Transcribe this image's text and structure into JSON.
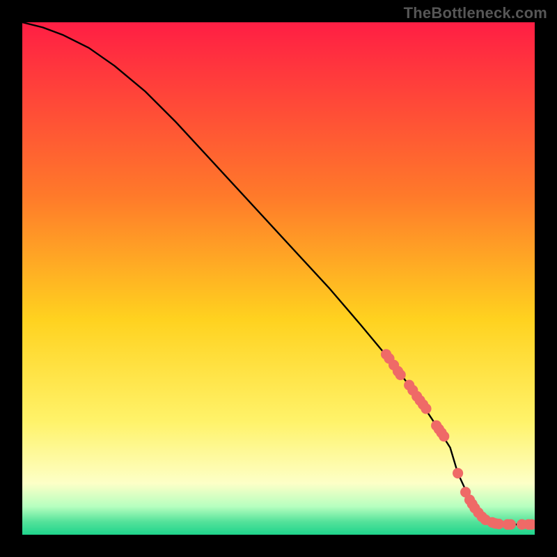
{
  "attribution": "TheBottleneck.com",
  "colors": {
    "bg_black": "#000000",
    "grad_top": "#ff1e44",
    "grad_mid1": "#ff7a2a",
    "grad_mid2": "#ffd21f",
    "grad_mid3": "#fff36a",
    "grad_mid4": "#fdffc7",
    "grad_green1": "#b6ffbf",
    "grad_green2": "#53e29a",
    "grad_green3": "#1fd48c",
    "curve": "#000000",
    "dot": "#ef6a67"
  },
  "chart_data": {
    "type": "line",
    "title": "",
    "xlabel": "",
    "ylabel": "",
    "xlim": [
      0,
      100
    ],
    "ylim": [
      0,
      100
    ],
    "series": [
      {
        "name": "curve",
        "x": [
          0,
          4,
          8,
          13,
          18,
          24,
          30,
          36,
          42,
          48,
          54,
          60,
          66,
          71,
          76,
          80,
          83.5,
          85,
          88,
          92,
          96,
          100
        ],
        "y": [
          100,
          99,
          97.5,
          95,
          91.5,
          86.5,
          80.5,
          74,
          67.5,
          61,
          54.5,
          48,
          41,
          35,
          28.5,
          22.5,
          17,
          12,
          5.5,
          2.2,
          2.0,
          2.0
        ]
      }
    ],
    "dots": {
      "name": "scatter",
      "x": [
        71.0,
        71.6,
        72.5,
        73.3,
        73.8,
        75.5,
        76.2,
        77.0,
        77.6,
        78.2,
        78.8,
        80.8,
        81.3,
        81.8,
        82.3,
        85.0,
        86.5,
        87.3,
        87.8,
        88.3,
        89.0,
        89.7,
        90.4,
        91.7,
        92.3,
        93.0,
        94.7,
        95.3,
        97.5,
        98.8,
        99.4
      ],
      "y": [
        35.2,
        34.4,
        33.1,
        31.9,
        31.2,
        29.2,
        28.2,
        27.0,
        26.2,
        25.4,
        24.6,
        21.3,
        20.6,
        19.9,
        19.2,
        12.0,
        8.3,
        6.8,
        6.0,
        5.2,
        4.3,
        3.5,
        2.9,
        2.4,
        2.2,
        2.1,
        2.0,
        2.0,
        2.0,
        2.0,
        2.0
      ]
    }
  }
}
